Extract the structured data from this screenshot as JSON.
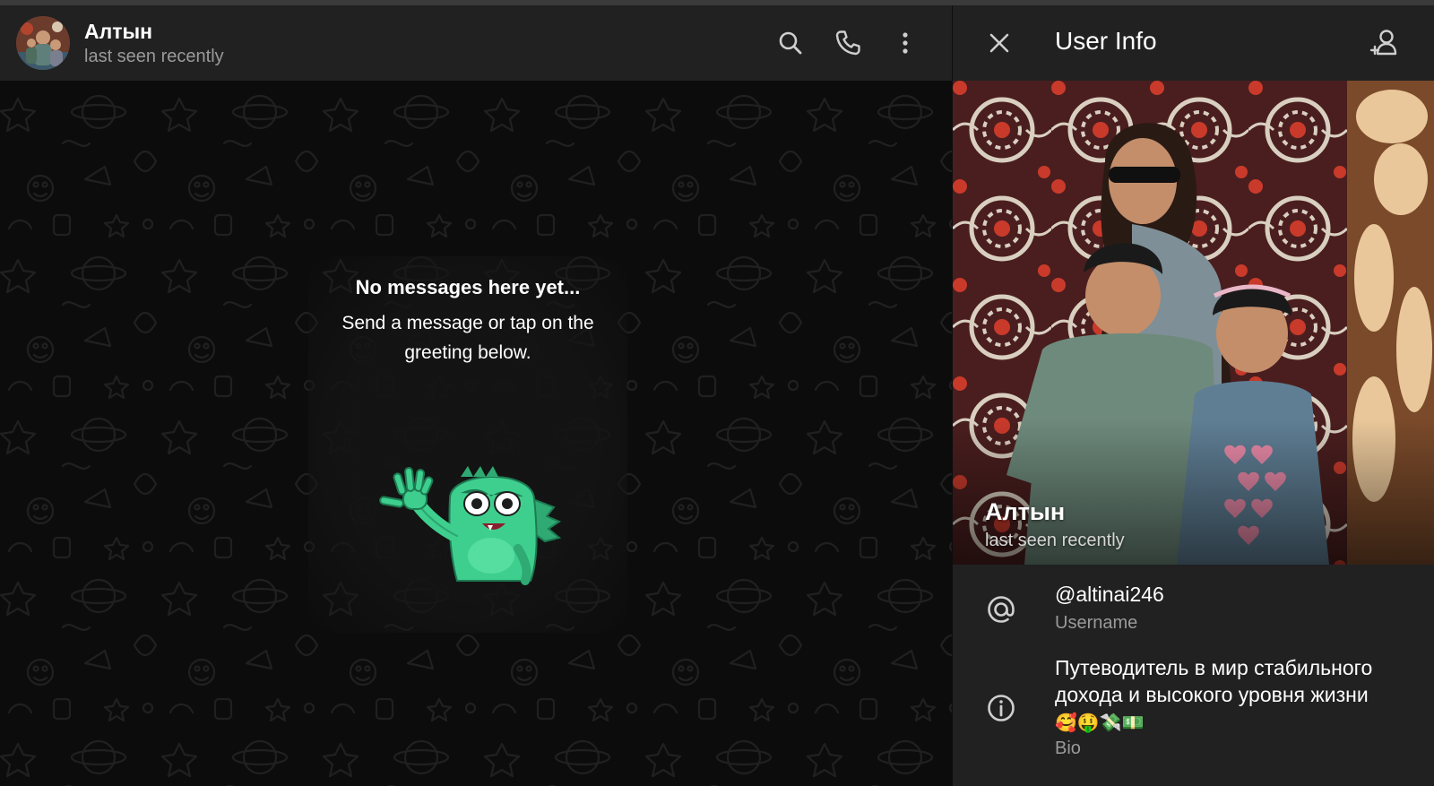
{
  "chat": {
    "name": "Алтын",
    "status": "last seen recently",
    "empty_state": {
      "title": "No messages here yet...",
      "subtitle": "Send a message or tap on the greeting below."
    },
    "sticker_icon": "waving-green-monster-sticker"
  },
  "header_icons": [
    "search-icon",
    "phone-icon",
    "more-vertical-icon"
  ],
  "panel": {
    "title": "User Info",
    "close_icon": "close-icon",
    "add_contact_icon": "add-contact-icon",
    "profile_name": "Алтын",
    "profile_status": "last seen recently",
    "username": {
      "value": "@altinai246",
      "label": "Username",
      "icon": "at-icon"
    },
    "bio": {
      "value": "Путеводитель в мир стабильного дохода и высокого уровня жизни",
      "emoji": "🥰🤑💸💵",
      "label": "Bio",
      "icon": "info-icon"
    }
  },
  "colors": {
    "header_bg": "#212121",
    "chat_bg": "#0b0b0b",
    "secondary_text": "#9a9a9a",
    "sticker_green": "#3ecf8e"
  }
}
